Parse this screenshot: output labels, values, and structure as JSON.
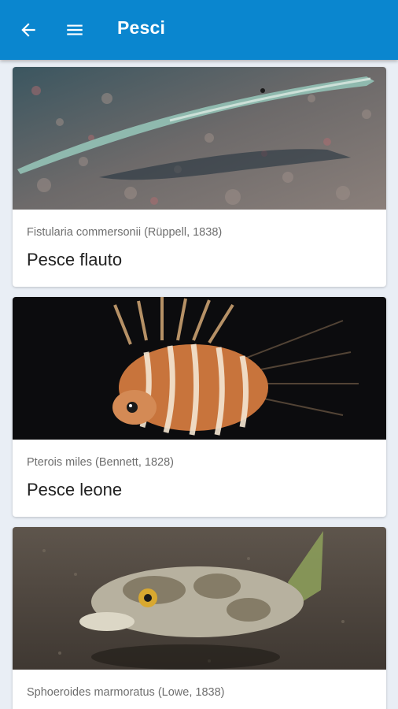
{
  "appbar": {
    "title": "Pesci",
    "back_icon": "arrow-back-icon",
    "menu_icon": "hamburger-menu-icon",
    "color": "#0a86cf"
  },
  "fish": [
    {
      "scientific_name": "Fistularia commersonii (Rüppell, 1838)",
      "common_name": "Pesce flauto"
    },
    {
      "scientific_name": "Pterois miles (Bennett, 1828)",
      "common_name": "Pesce leone"
    },
    {
      "scientific_name": "Sphoeroides marmoratus (Lowe, 1838)",
      "common_name": ""
    }
  ]
}
